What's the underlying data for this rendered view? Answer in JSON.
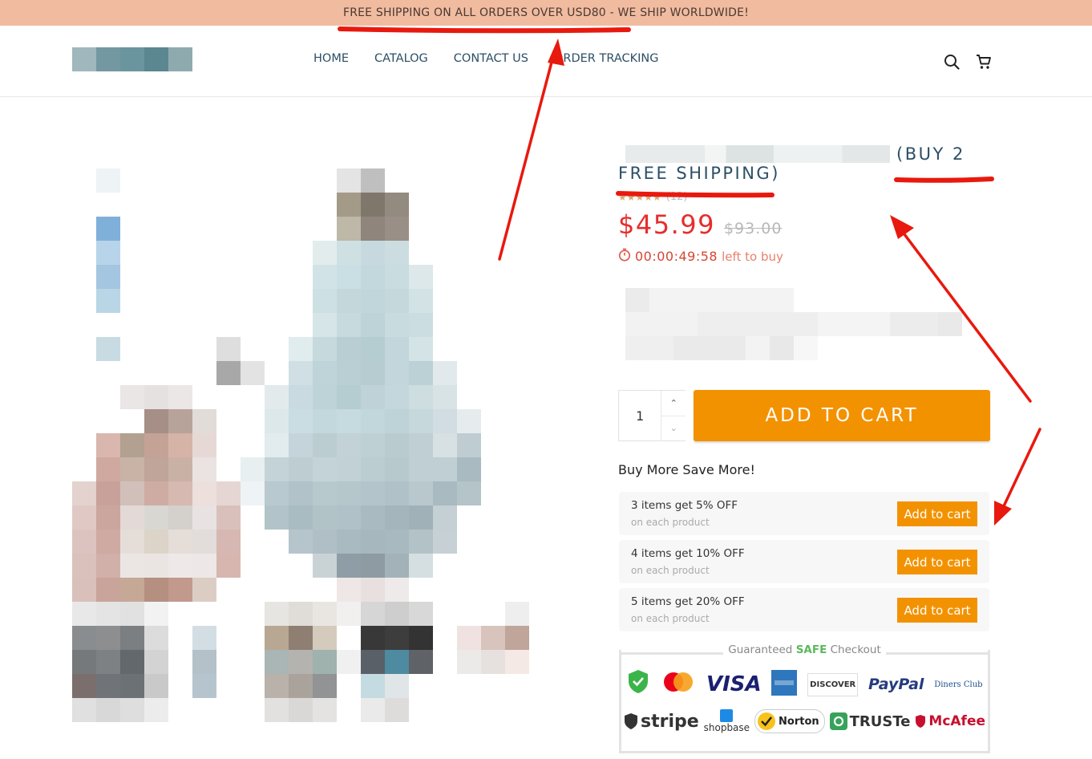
{
  "announcement": "FREE SHIPPING ON ALL ORDERS OVER USD80 - WE SHIP WORLDWIDE!",
  "nav": [
    "HOME",
    "CATALOG",
    "CONTACT US",
    "ORDER TRACKING"
  ],
  "header_icons": [
    "search-icon",
    "cart-icon"
  ],
  "product": {
    "title_suffix": "(BUY 2",
    "title_line2": "FREE SHIPPING)",
    "stars": "★★★★★",
    "review_count": "(12)",
    "price": "$45.99",
    "compare_price": "$93.00",
    "timer": "00:00:49:58",
    "timer_suffix": "left to buy"
  },
  "quantity": "1",
  "add_to_cart": "ADD TO CART",
  "bundle_title": "Buy More Save More!",
  "offers": [
    {
      "title": "3 items get 5% OFF",
      "sub": "on each product",
      "button": "Add to cart"
    },
    {
      "title": "4 items get 10% OFF",
      "sub": "on each product",
      "button": "Add to cart"
    },
    {
      "title": "5 items get 20% OFF",
      "sub": "on each product",
      "button": "Add to cart"
    }
  ],
  "checkout": {
    "prefix": "Guaranteed",
    "safe": "SAFE",
    "suffix": "Checkout"
  },
  "payment_badges": {
    "row1": [
      "",
      "",
      "VISA",
      "",
      "DISCOVER",
      "PayPal",
      "Diners Club"
    ],
    "row2": [
      "stripe",
      "shopbase",
      "Norton",
      "TRUSTe",
      "McAfee"
    ]
  },
  "colors": {
    "accent": "#f39200",
    "price": "#e62d2d",
    "banner": "#f1bba0",
    "nav": "#2c4f66",
    "annotation": "#e8190e"
  }
}
